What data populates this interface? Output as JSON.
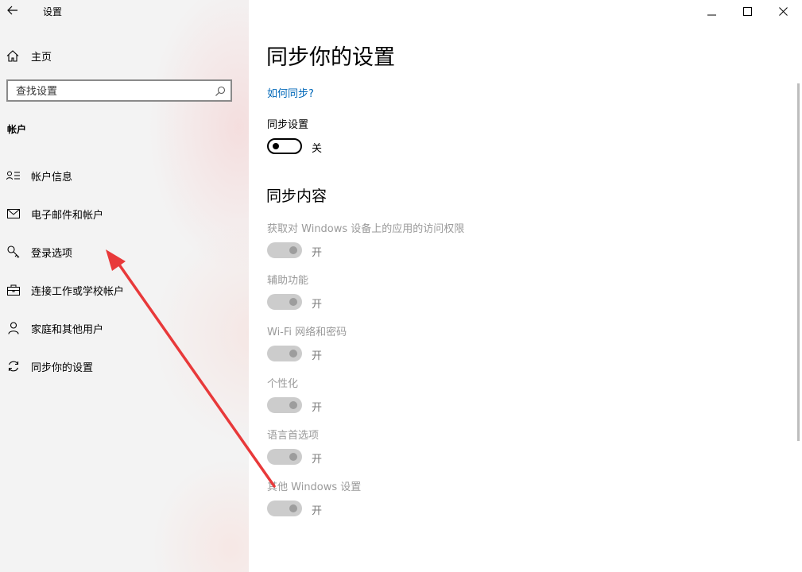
{
  "window": {
    "title": "设置",
    "controls": {
      "minimize": "minimize-icon",
      "maximize": "maximize-icon",
      "close": "close-icon"
    }
  },
  "sidebar": {
    "home_label": "主页",
    "search_placeholder": "查找设置",
    "section_title": "帐户",
    "items": [
      {
        "label": "帐户信息",
        "icon": "account-info-icon"
      },
      {
        "label": "电子邮件和帐户",
        "icon": "mail-icon"
      },
      {
        "label": "登录选项",
        "icon": "key-icon"
      },
      {
        "label": "连接工作或学校帐户",
        "icon": "briefcase-icon"
      },
      {
        "label": "家庭和其他用户",
        "icon": "person-icon"
      },
      {
        "label": "同步你的设置",
        "icon": "sync-icon"
      }
    ]
  },
  "main": {
    "title": "同步你的设置",
    "help_link": "如何同步?",
    "sync_settings": {
      "label": "同步设置",
      "state": "关"
    },
    "section_title": "同步内容",
    "items": [
      {
        "label": "获取对 Windows 设备上的应用的访问权限",
        "state": "开"
      },
      {
        "label": "辅助功能",
        "state": "开"
      },
      {
        "label": "Wi-Fi 网络和密码",
        "state": "开"
      },
      {
        "label": "个性化",
        "state": "开"
      },
      {
        "label": "语言首选项",
        "state": "开"
      },
      {
        "label": "其他 Windows 设置",
        "state": "开"
      }
    ]
  },
  "colors": {
    "link": "#0067b8",
    "annotation_arrow": "#e8393a",
    "disabled_text": "#9a9a9a"
  }
}
